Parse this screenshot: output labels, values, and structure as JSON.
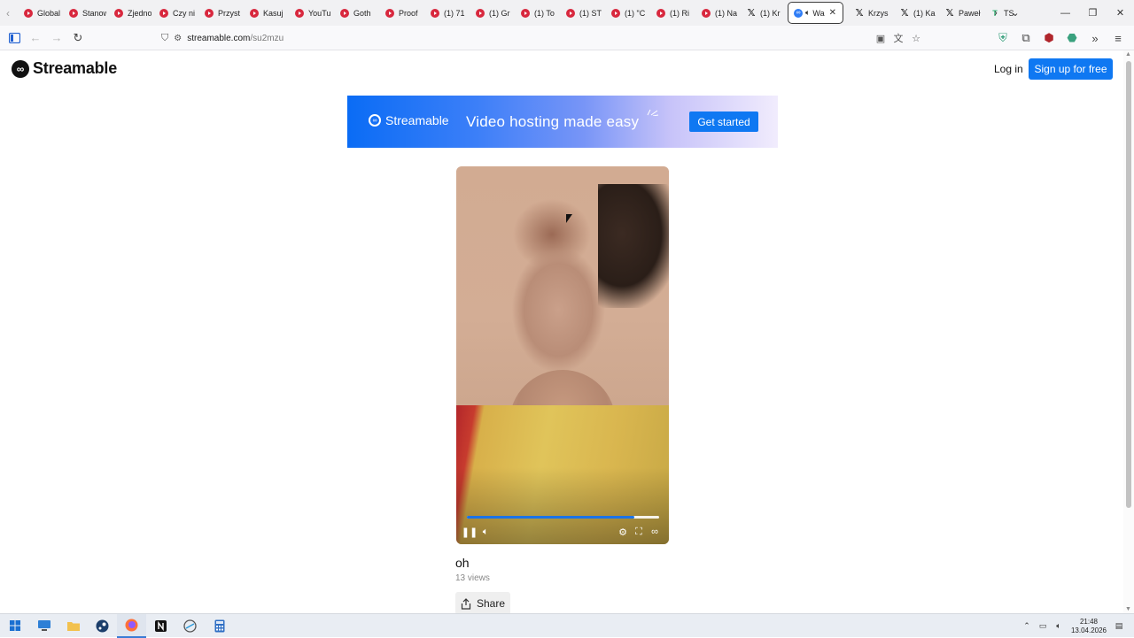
{
  "browser": {
    "tabs": [
      {
        "label": "Global",
        "icon": "youtube-icon"
      },
      {
        "label": "Stanow",
        "icon": "youtube-icon"
      },
      {
        "label": "Zjedno",
        "icon": "youtube-icon"
      },
      {
        "label": "Czy ni",
        "icon": "youtube-icon"
      },
      {
        "label": "Przyst",
        "icon": "youtube-icon"
      },
      {
        "label": "Kasuj",
        "icon": "youtube-icon"
      },
      {
        "label": "YouTu",
        "icon": "youtube-icon"
      },
      {
        "label": "Goth",
        "icon": "youtube-icon"
      },
      {
        "label": "Proof",
        "icon": "youtube-icon"
      },
      {
        "label": "(1) 71",
        "icon": "youtube-icon"
      },
      {
        "label": "(1) Gr",
        "icon": "youtube-icon"
      },
      {
        "label": "(1) To",
        "icon": "youtube-icon"
      },
      {
        "label": "(1) ST",
        "icon": "youtube-icon"
      },
      {
        "label": "(1) \"C",
        "icon": "youtube-icon"
      },
      {
        "label": "(1) Ri",
        "icon": "youtube-icon"
      },
      {
        "label": "(1) Na",
        "icon": "youtube-icon"
      },
      {
        "label": "(1) Kr",
        "icon": "x-icon"
      }
    ],
    "active_tab": {
      "label": "Wa",
      "icon": "streamable-icon",
      "close": "✕"
    },
    "tabs_after": [
      {
        "label": "Krzys",
        "icon": "x-icon"
      },
      {
        "label": "(1) Ka",
        "icon": "x-icon"
      },
      {
        "label": "Paweł",
        "icon": "x-icon"
      },
      {
        "label": "TS",
        "icon": "site-icon"
      }
    ],
    "url": {
      "host": "streamable.com",
      "path": "/su2mzu"
    }
  },
  "site": {
    "brand": "Streamable",
    "login": "Log in",
    "signup": "Sign up for free"
  },
  "banner": {
    "brand": "Streamable",
    "tagline": "Video hosting made easy",
    "cta": "Get started"
  },
  "video": {
    "title": "oh",
    "views": "13 views",
    "share": "Share",
    "progress_fraction": 0.87
  },
  "taskbar": {
    "time": "21:48",
    "date": "13.04.2026"
  },
  "colors": {
    "accent": "#0f78f2",
    "youtube": "#d8283e",
    "progress": "#1a73e8"
  }
}
